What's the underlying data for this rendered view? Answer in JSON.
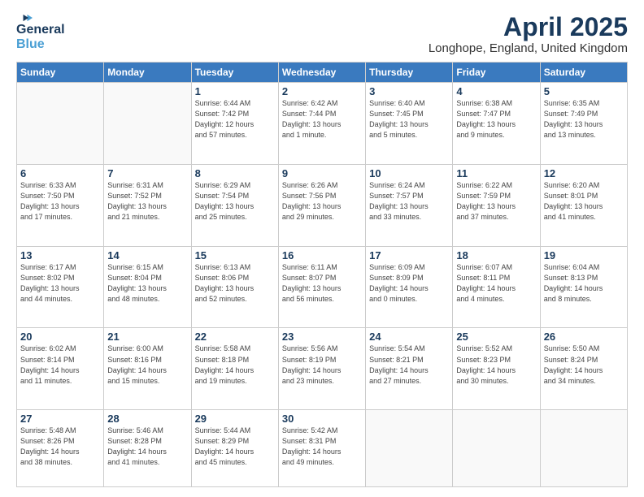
{
  "logo": {
    "line1": "General",
    "line2": "Blue",
    "icon": "▶"
  },
  "title": "April 2025",
  "location": "Longhope, England, United Kingdom",
  "days_header": [
    "Sunday",
    "Monday",
    "Tuesday",
    "Wednesday",
    "Thursday",
    "Friday",
    "Saturday"
  ],
  "weeks": [
    [
      {
        "day": "",
        "info": ""
      },
      {
        "day": "",
        "info": ""
      },
      {
        "day": "1",
        "info": "Sunrise: 6:44 AM\nSunset: 7:42 PM\nDaylight: 12 hours\nand 57 minutes."
      },
      {
        "day": "2",
        "info": "Sunrise: 6:42 AM\nSunset: 7:44 PM\nDaylight: 13 hours\nand 1 minute."
      },
      {
        "day": "3",
        "info": "Sunrise: 6:40 AM\nSunset: 7:45 PM\nDaylight: 13 hours\nand 5 minutes."
      },
      {
        "day": "4",
        "info": "Sunrise: 6:38 AM\nSunset: 7:47 PM\nDaylight: 13 hours\nand 9 minutes."
      },
      {
        "day": "5",
        "info": "Sunrise: 6:35 AM\nSunset: 7:49 PM\nDaylight: 13 hours\nand 13 minutes."
      }
    ],
    [
      {
        "day": "6",
        "info": "Sunrise: 6:33 AM\nSunset: 7:50 PM\nDaylight: 13 hours\nand 17 minutes."
      },
      {
        "day": "7",
        "info": "Sunrise: 6:31 AM\nSunset: 7:52 PM\nDaylight: 13 hours\nand 21 minutes."
      },
      {
        "day": "8",
        "info": "Sunrise: 6:29 AM\nSunset: 7:54 PM\nDaylight: 13 hours\nand 25 minutes."
      },
      {
        "day": "9",
        "info": "Sunrise: 6:26 AM\nSunset: 7:56 PM\nDaylight: 13 hours\nand 29 minutes."
      },
      {
        "day": "10",
        "info": "Sunrise: 6:24 AM\nSunset: 7:57 PM\nDaylight: 13 hours\nand 33 minutes."
      },
      {
        "day": "11",
        "info": "Sunrise: 6:22 AM\nSunset: 7:59 PM\nDaylight: 13 hours\nand 37 minutes."
      },
      {
        "day": "12",
        "info": "Sunrise: 6:20 AM\nSunset: 8:01 PM\nDaylight: 13 hours\nand 41 minutes."
      }
    ],
    [
      {
        "day": "13",
        "info": "Sunrise: 6:17 AM\nSunset: 8:02 PM\nDaylight: 13 hours\nand 44 minutes."
      },
      {
        "day": "14",
        "info": "Sunrise: 6:15 AM\nSunset: 8:04 PM\nDaylight: 13 hours\nand 48 minutes."
      },
      {
        "day": "15",
        "info": "Sunrise: 6:13 AM\nSunset: 8:06 PM\nDaylight: 13 hours\nand 52 minutes."
      },
      {
        "day": "16",
        "info": "Sunrise: 6:11 AM\nSunset: 8:07 PM\nDaylight: 13 hours\nand 56 minutes."
      },
      {
        "day": "17",
        "info": "Sunrise: 6:09 AM\nSunset: 8:09 PM\nDaylight: 14 hours\nand 0 minutes."
      },
      {
        "day": "18",
        "info": "Sunrise: 6:07 AM\nSunset: 8:11 PM\nDaylight: 14 hours\nand 4 minutes."
      },
      {
        "day": "19",
        "info": "Sunrise: 6:04 AM\nSunset: 8:13 PM\nDaylight: 14 hours\nand 8 minutes."
      }
    ],
    [
      {
        "day": "20",
        "info": "Sunrise: 6:02 AM\nSunset: 8:14 PM\nDaylight: 14 hours\nand 11 minutes."
      },
      {
        "day": "21",
        "info": "Sunrise: 6:00 AM\nSunset: 8:16 PM\nDaylight: 14 hours\nand 15 minutes."
      },
      {
        "day": "22",
        "info": "Sunrise: 5:58 AM\nSunset: 8:18 PM\nDaylight: 14 hours\nand 19 minutes."
      },
      {
        "day": "23",
        "info": "Sunrise: 5:56 AM\nSunset: 8:19 PM\nDaylight: 14 hours\nand 23 minutes."
      },
      {
        "day": "24",
        "info": "Sunrise: 5:54 AM\nSunset: 8:21 PM\nDaylight: 14 hours\nand 27 minutes."
      },
      {
        "day": "25",
        "info": "Sunrise: 5:52 AM\nSunset: 8:23 PM\nDaylight: 14 hours\nand 30 minutes."
      },
      {
        "day": "26",
        "info": "Sunrise: 5:50 AM\nSunset: 8:24 PM\nDaylight: 14 hours\nand 34 minutes."
      }
    ],
    [
      {
        "day": "27",
        "info": "Sunrise: 5:48 AM\nSunset: 8:26 PM\nDaylight: 14 hours\nand 38 minutes."
      },
      {
        "day": "28",
        "info": "Sunrise: 5:46 AM\nSunset: 8:28 PM\nDaylight: 14 hours\nand 41 minutes."
      },
      {
        "day": "29",
        "info": "Sunrise: 5:44 AM\nSunset: 8:29 PM\nDaylight: 14 hours\nand 45 minutes."
      },
      {
        "day": "30",
        "info": "Sunrise: 5:42 AM\nSunset: 8:31 PM\nDaylight: 14 hours\nand 49 minutes."
      },
      {
        "day": "",
        "info": ""
      },
      {
        "day": "",
        "info": ""
      },
      {
        "day": "",
        "info": ""
      }
    ]
  ]
}
